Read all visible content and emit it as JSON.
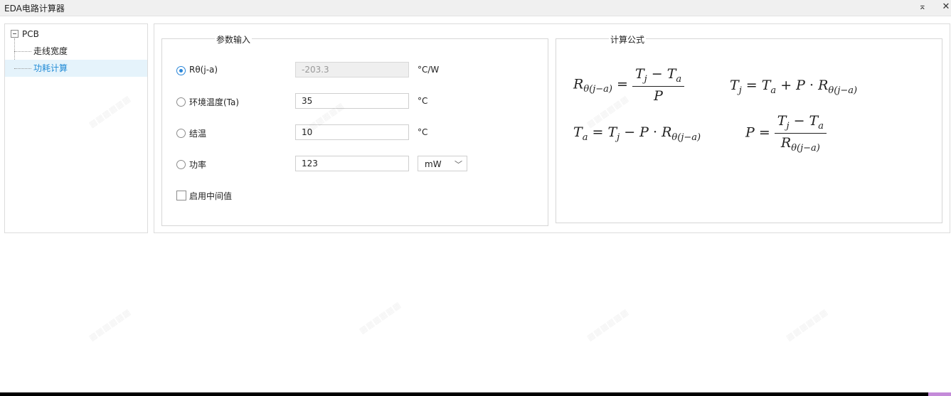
{
  "window": {
    "title": "EDA电路计算器",
    "min_icon": "minimize-icon",
    "close_icon": "close-icon"
  },
  "tree": {
    "root": "PCB",
    "items": [
      {
        "label": "走线宽度",
        "selected": false
      },
      {
        "label": "功耗计算",
        "selected": true
      }
    ]
  },
  "params": {
    "group_title": "参数输入",
    "rows": [
      {
        "label": "Rθ(j-a)",
        "value": "-203.3",
        "unit": "°C/W",
        "checked": true,
        "disabled": true
      },
      {
        "label": "环境温度(Ta)",
        "value": "35",
        "unit": "°C",
        "checked": false
      },
      {
        "label": "结温",
        "value": "10",
        "unit": "°C",
        "checked": false
      },
      {
        "label": "功率",
        "value": "123",
        "unit_select": "mW",
        "checked": false
      }
    ],
    "intermediate_label": "启用中间值",
    "intermediate_checked": false
  },
  "formula": {
    "group_title": "计算公式"
  },
  "colors": {
    "accent": "#2a86d8",
    "tree_selected_bg": "#e5f3fb",
    "tree_selected_text": "#1f8ad6"
  }
}
